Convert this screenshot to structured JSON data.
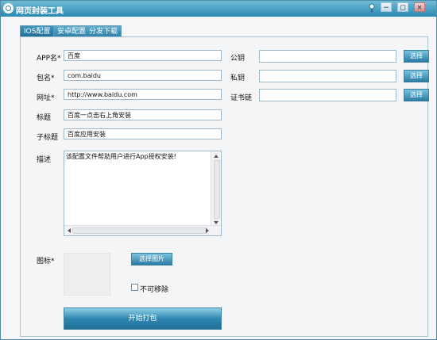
{
  "window": {
    "title": "网页封装工具"
  },
  "titlebar_buttons": {
    "minimize": "−",
    "restore": "◻",
    "close": "×"
  },
  "tabs": [
    {
      "label": "IOS配置",
      "active": true
    },
    {
      "label": "安卓配置",
      "active": false
    },
    {
      "label": "分发下载",
      "active": false
    }
  ],
  "form": {
    "app_name": {
      "label": "APP名*",
      "value": "百度"
    },
    "package": {
      "label": "包名*",
      "value": "com.baidu"
    },
    "url": {
      "label": "网址*",
      "value": "http://www.baidu.com"
    },
    "title": {
      "label": "标题",
      "value": "百度一点击右上角安装"
    },
    "subtitle": {
      "label": "子标题",
      "value": "百度应用安装"
    },
    "description": {
      "label": "描述",
      "value": "该配置文件帮助用户进行App授权安装!"
    },
    "icon": {
      "label": "图标*"
    },
    "pick_image_button": "选择图片",
    "non_removable_checkbox": {
      "label": "不可移除",
      "checked": false
    },
    "start_pack_button": "开始打包"
  },
  "certs": {
    "public_key": {
      "label": "公钥",
      "value": "",
      "button": "选择"
    },
    "private_key": {
      "label": "私钥",
      "value": "",
      "button": "选择"
    },
    "cert_chain": {
      "label": "证书链",
      "value": "",
      "button": "选择"
    }
  },
  "colors": {
    "accent": "#2b88b0",
    "accent_light": "#7ac3de",
    "border": "#9fb8c6"
  }
}
